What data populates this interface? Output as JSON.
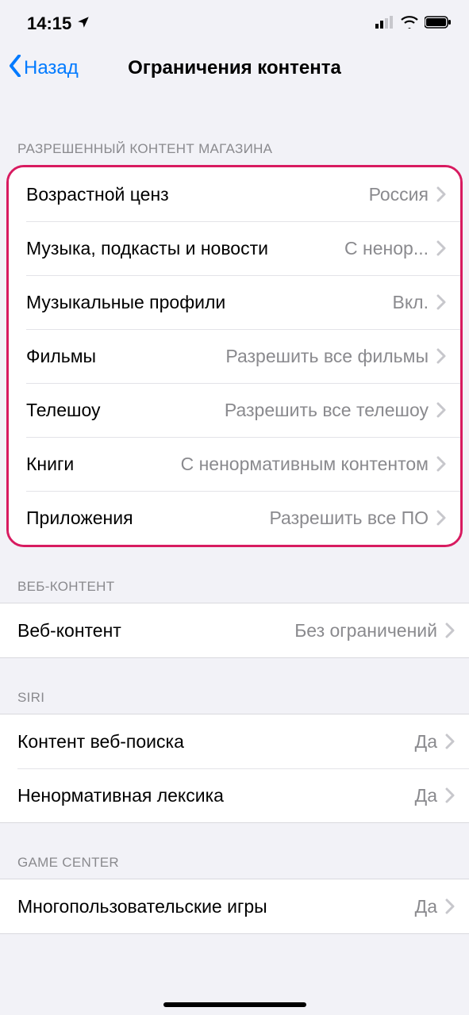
{
  "status": {
    "time": "14:15"
  },
  "nav": {
    "back": "Назад",
    "title": "Ограничения контента"
  },
  "section_store": {
    "header": "РАЗРЕШЕННЫЙ КОНТЕНТ МАГАЗИНА",
    "rows": [
      {
        "label": "Возрастной ценз",
        "value": "Россия"
      },
      {
        "label": "Музыка, подкасты и новости",
        "value": "С ненор..."
      },
      {
        "label": "Музыкальные профили",
        "value": "Вкл."
      },
      {
        "label": "Фильмы",
        "value": "Разрешить все фильмы"
      },
      {
        "label": "Телешоу",
        "value": "Разрешить все телешоу"
      },
      {
        "label": "Книги",
        "value": "С ненормативным контентом"
      },
      {
        "label": "Приложения",
        "value": "Разрешить все ПО"
      }
    ]
  },
  "section_web": {
    "header": "ВЕБ-КОНТЕНТ",
    "rows": [
      {
        "label": "Веб-контент",
        "value": "Без ограничений"
      }
    ]
  },
  "section_siri": {
    "header": "SIRI",
    "rows": [
      {
        "label": "Контент веб-поиска",
        "value": "Да"
      },
      {
        "label": "Ненормативная лексика",
        "value": "Да"
      }
    ]
  },
  "section_gamecenter": {
    "header": "GAME CENTER",
    "rows": [
      {
        "label": "Многопользовательские игры",
        "value": "Да"
      }
    ]
  }
}
